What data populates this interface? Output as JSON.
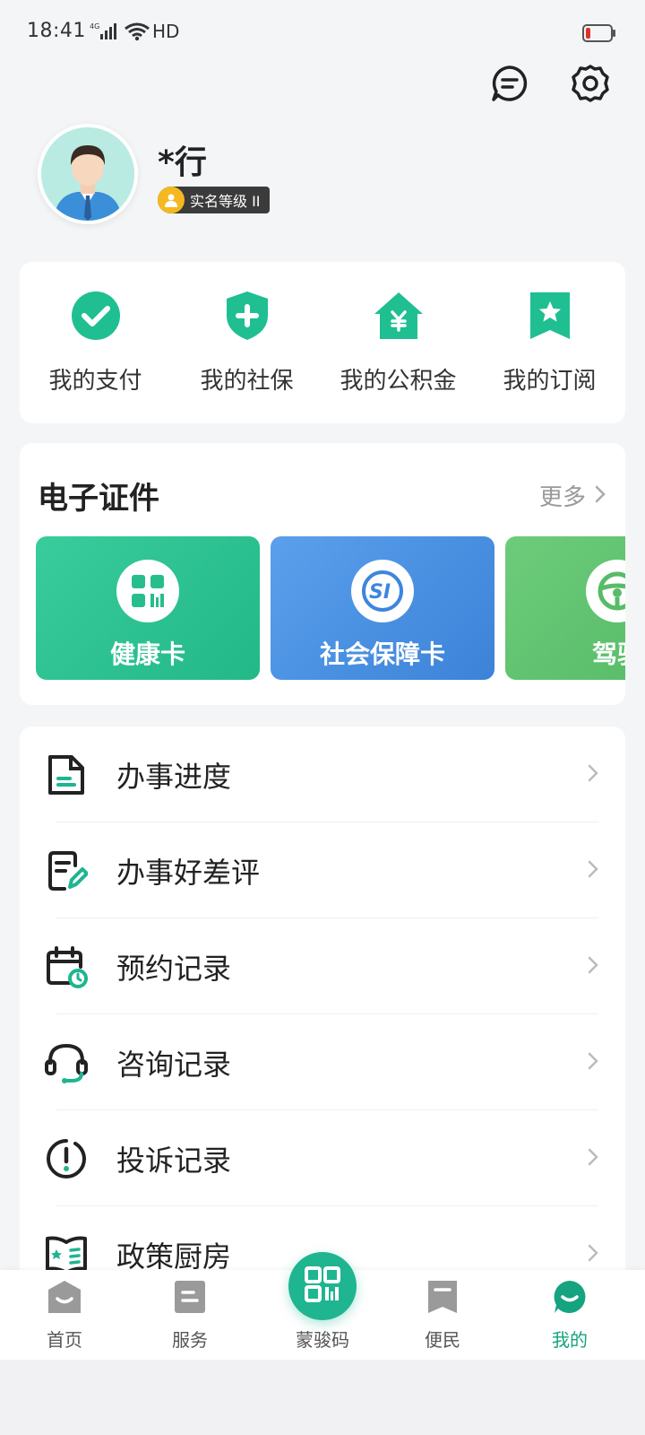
{
  "status_bar": {
    "time": "18:41",
    "network": "4G",
    "wifi_label": "HD"
  },
  "header": {
    "message_icon": "message-icon",
    "settings_icon": "gear-icon"
  },
  "profile": {
    "name": "*行",
    "badge": "实名等级 II"
  },
  "quick_actions": [
    {
      "label": "我的支付",
      "icon": "check-circle-icon"
    },
    {
      "label": "我的社保",
      "icon": "shield-plus-icon"
    },
    {
      "label": "我的公积金",
      "icon": "house-yen-icon"
    },
    {
      "label": "我的订阅",
      "icon": "bookmark-star-icon"
    }
  ],
  "certificates": {
    "title": "电子证件",
    "more": "更多",
    "cards": [
      {
        "label": "健康卡",
        "icon": "health-code-icon",
        "color": "#2fc497"
      },
      {
        "label": "社会保障卡",
        "icon": "social-security-icon",
        "color": "#4a8fe0"
      },
      {
        "label": "驾驶",
        "icon": "steering-wheel-icon",
        "color": "#5cbf6e"
      }
    ]
  },
  "menu": [
    {
      "label": "办事进度",
      "icon": "document-progress-icon"
    },
    {
      "label": "办事好差评",
      "icon": "review-edit-icon"
    },
    {
      "label": "预约记录",
      "icon": "calendar-clock-icon"
    },
    {
      "label": "咨询记录",
      "icon": "headset-icon"
    },
    {
      "label": "投诉记录",
      "icon": "exclamation-circle-icon"
    },
    {
      "label": "政策厨房",
      "icon": "book-star-icon"
    }
  ],
  "bottom_nav": [
    {
      "label": "首页",
      "icon": "home-tab-icon"
    },
    {
      "label": "服务",
      "icon": "service-tab-icon"
    },
    {
      "label": "蒙骏码",
      "icon": "qr-code-icon"
    },
    {
      "label": "便民",
      "icon": "bookmark-tab-icon"
    },
    {
      "label": "我的",
      "icon": "profile-tab-icon"
    }
  ],
  "colors": {
    "accent": "#1fb591",
    "active_tab": "#16a37f"
  }
}
